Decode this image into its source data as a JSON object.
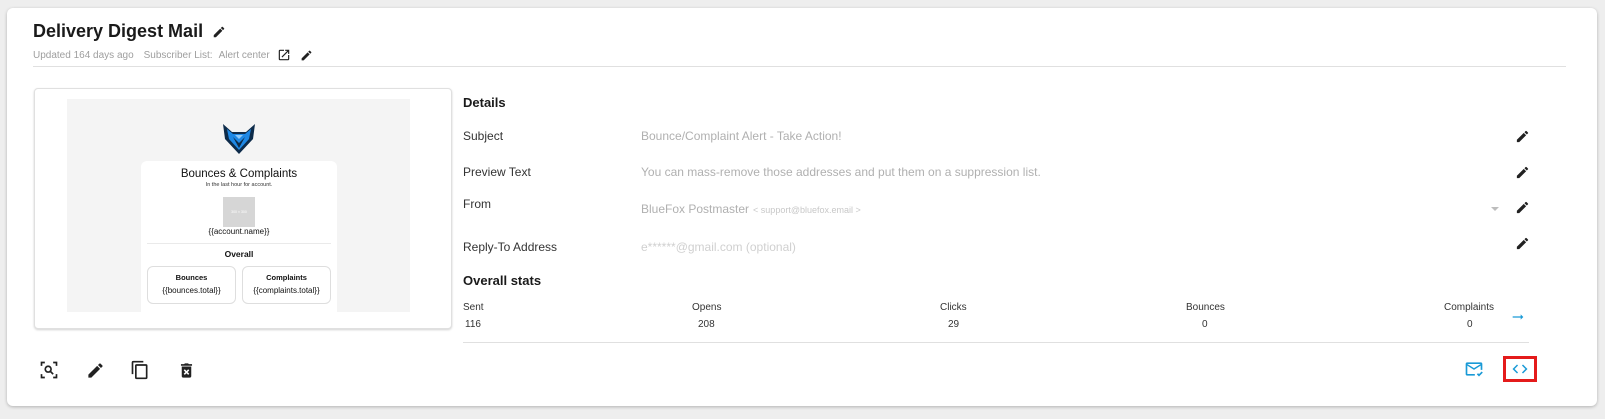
{
  "header": {
    "title": "Delivery Digest Mail",
    "updated": "Updated 164 days ago",
    "subscriber_label": "Subscriber List:",
    "subscriber_value": "Alert center"
  },
  "preview": {
    "title": "Bounces & Complaints",
    "subtitle": "In the last hour for account.",
    "image_placeholder": "300 × 300",
    "account": "{{account.name}}",
    "overall": "Overall",
    "boxes": [
      {
        "label": "Bounces",
        "value": "{{bounces.total}}"
      },
      {
        "label": "Complaints",
        "value": "{{complaints.total}}"
      }
    ]
  },
  "details": {
    "heading": "Details",
    "subject_label": "Subject",
    "subject_value": "Bounce/Complaint Alert - Take Action!",
    "preview_label": "Preview Text",
    "preview_value": "You can mass-remove those addresses and put them on a suppression list.",
    "from_label": "From",
    "from_name": "BlueFox Postmaster",
    "from_email": "< support@bluefox.email >",
    "reply_label": "Reply-To Address",
    "reply_value": "e******@gmail.com (optional)"
  },
  "stats": {
    "heading": "Overall stats",
    "items": [
      {
        "label": "Sent",
        "value": "116"
      },
      {
        "label": "Opens",
        "value": "208"
      },
      {
        "label": "Clicks",
        "value": "29"
      },
      {
        "label": "Bounces",
        "value": "0"
      },
      {
        "label": "Complaints",
        "value": "0"
      }
    ]
  },
  "colors": {
    "accent": "#1a9ad6",
    "highlight": "#e41b1b",
    "logo_blue": "#1e88e5",
    "logo_dark": "#0d2b4a"
  },
  "icons": {
    "title_edit": "pencil-icon",
    "open_external": "open-in-new-icon",
    "subscriber_edit": "pencil-icon",
    "arrow": "arrow-right-icon",
    "toolbar": [
      "zoom-preview-icon",
      "pencil-icon",
      "copy-icon",
      "delete-icon"
    ],
    "send_test": "mail-check-icon",
    "code": "code-brackets-icon"
  }
}
